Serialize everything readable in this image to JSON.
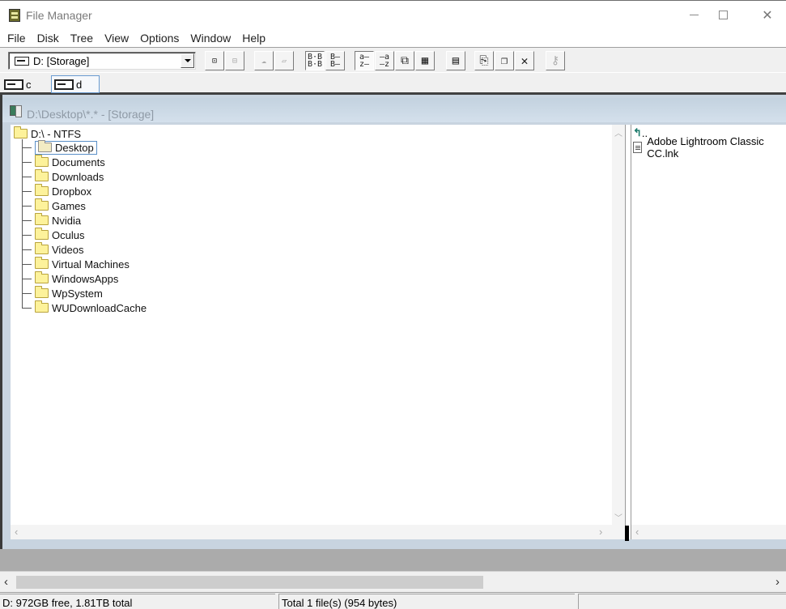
{
  "window": {
    "title": "File Manager",
    "controls": {
      "minimize": "minimize",
      "maximize": "maximize",
      "close": "close"
    }
  },
  "menu": [
    "File",
    "Disk",
    "Tree",
    "View",
    "Options",
    "Window",
    "Help"
  ],
  "toolbar": {
    "drive_select": {
      "value": "D: [Storage]"
    },
    "buttons": [
      {
        "name": "connect-network-drive",
        "icon": "network-connect-icon",
        "state": "normal"
      },
      {
        "name": "disconnect-network-drive",
        "icon": "network-disconnect-icon",
        "state": "disabled"
      },
      {
        "name": "share-as",
        "icon": "share-icon",
        "state": "disabled"
      },
      {
        "name": "stop-sharing",
        "icon": "stop-share-icon",
        "state": "disabled"
      },
      {
        "name": "large-icons",
        "icon": "large-icons-view-icon",
        "glyph": "B-B-\nB-B-",
        "state": "pressed"
      },
      {
        "name": "list-view",
        "icon": "list-view-icon",
        "glyph": "B—\nB—",
        "state": "normal"
      },
      {
        "name": "sort-by-name",
        "icon": "sort-name-icon",
        "glyph": "a.—\nz.—",
        "state": "pressed"
      },
      {
        "name": "sort-by-type",
        "icon": "sort-type-icon",
        "glyph": "—.a\n—.z",
        "state": "normal"
      },
      {
        "name": "sort-by-size",
        "icon": "sort-size-icon",
        "glyph": "⧉",
        "state": "normal"
      },
      {
        "name": "sort-by-date",
        "icon": "sort-date-icon",
        "glyph": "▦",
        "state": "normal"
      },
      {
        "name": "new-window",
        "icon": "new-window-icon",
        "glyph": "▭",
        "state": "normal"
      },
      {
        "name": "copy",
        "icon": "copy-icon",
        "glyph": "⎘",
        "state": "normal"
      },
      {
        "name": "paste",
        "icon": "paste-icon",
        "glyph": "⎗",
        "state": "normal"
      },
      {
        "name": "delete",
        "icon": "delete-icon",
        "glyph": "✕",
        "state": "normal"
      },
      {
        "name": "properties",
        "icon": "properties-icon",
        "glyph": "✎",
        "state": "disabled"
      }
    ]
  },
  "drives": [
    {
      "letter": "c",
      "active": false
    },
    {
      "letter": "d",
      "active": true
    }
  ],
  "child_window": {
    "title": "D:\\Desktop\\*.* - [Storage]",
    "tree": {
      "root": "D:\\ - NTFS",
      "items": [
        {
          "label": "Desktop",
          "selected": true,
          "open": true
        },
        {
          "label": "Documents"
        },
        {
          "label": "Downloads"
        },
        {
          "label": "Dropbox"
        },
        {
          "label": "Games"
        },
        {
          "label": "Nvidia"
        },
        {
          "label": "Oculus"
        },
        {
          "label": "Videos"
        },
        {
          "label": "Virtual Machines"
        },
        {
          "label": "WindowsApps"
        },
        {
          "label": "WpSystem"
        },
        {
          "label": "WUDownloadCache"
        }
      ]
    },
    "files": {
      "parent_label": "..",
      "items": [
        {
          "name": "Adobe Lightroom Classic CC.lnk"
        }
      ]
    }
  },
  "status": {
    "disk": "D: 972GB free,  1.81TB total",
    "selection": "Total 1 file(s) (954 bytes)",
    "extra": ""
  },
  "scroll": {
    "main_horizontal_thumb_fraction": 0.62
  }
}
